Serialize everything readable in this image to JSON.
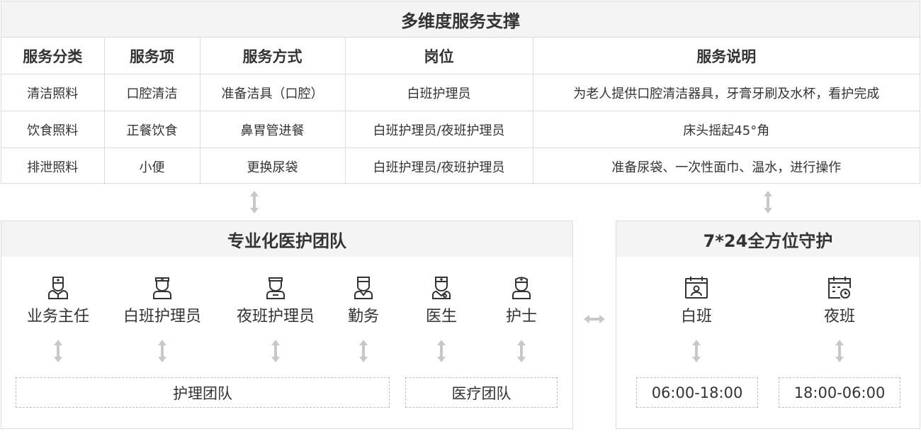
{
  "service_table": {
    "title": "多维度服务支撑",
    "headers": [
      "服务分类",
      "服务项",
      "服务方式",
      "岗位",
      "服务说明"
    ],
    "rows": [
      [
        "清洁照料",
        "口腔清洁",
        "准备洁具（口腔）",
        "白班护理员",
        "为老人提供口腔清洁器具，牙膏牙刷及水杯，看护完成"
      ],
      [
        "饮食照料",
        "正餐饮食",
        "鼻胃管进餐",
        "白班护理员/夜班护理员",
        "床头摇起45°角"
      ],
      [
        "排泄照料",
        "小便",
        "更换尿袋",
        "白班护理员/夜班护理员",
        "准备尿袋、一次性面巾、温水，进行操作"
      ]
    ]
  },
  "team": {
    "title": "专业化医护团队",
    "roles": [
      {
        "label": "业务主任",
        "icon": "director-icon"
      },
      {
        "label": "白班护理员",
        "icon": "day-caregiver-icon"
      },
      {
        "label": "夜班护理员",
        "icon": "night-caregiver-icon"
      },
      {
        "label": "勤务",
        "icon": "service-staff-icon"
      },
      {
        "label": "医生",
        "icon": "doctor-icon"
      },
      {
        "label": "护士",
        "icon": "nurse-icon"
      }
    ],
    "groups": {
      "care": "护理团队",
      "medical": "医疗团队"
    }
  },
  "shifts": {
    "title": "7*24全方位守护",
    "items": [
      {
        "label": "白班",
        "time": "06:00-18:00",
        "icon": "calendar-user-icon"
      },
      {
        "label": "夜班",
        "time": "18:00-06:00",
        "icon": "calendar-clock-icon"
      }
    ]
  },
  "colors": {
    "border": "#dcdcdc",
    "header_bg": "#f4f4f4",
    "text": "#333333",
    "arrow": "#c8c8c8"
  }
}
